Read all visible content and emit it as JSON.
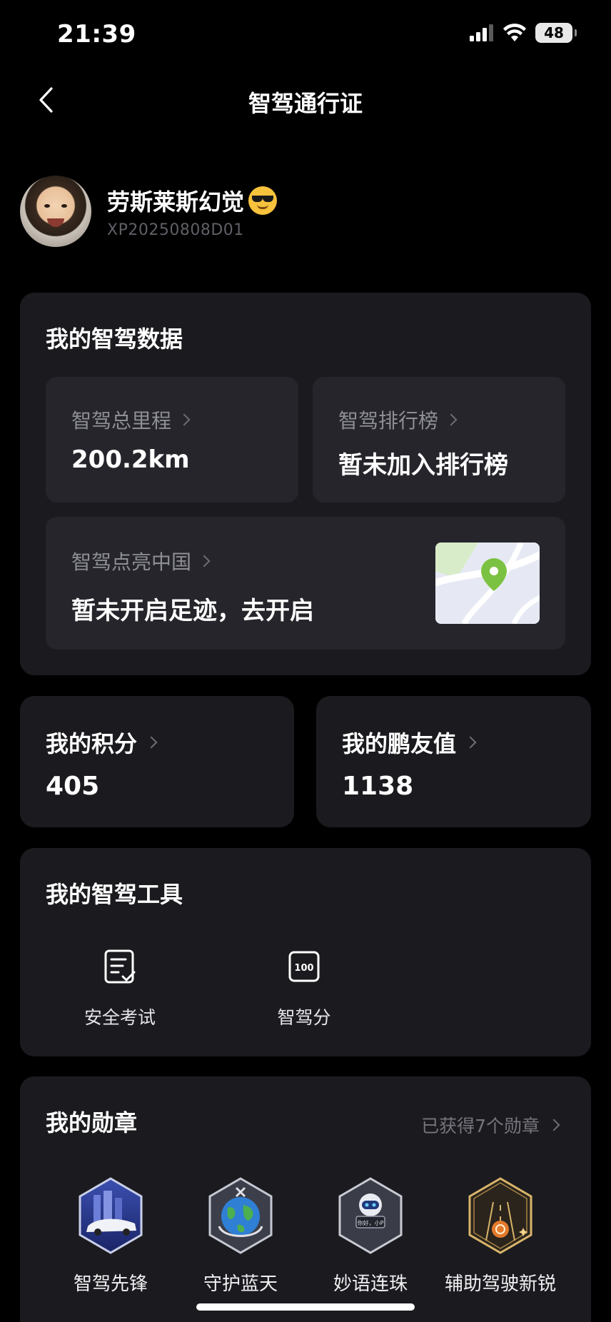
{
  "status_bar": {
    "time": "21:39",
    "battery": "48"
  },
  "nav": {
    "title": "智驾通行证"
  },
  "profile": {
    "name": "劳斯莱斯幻觉",
    "emoji": "sunglasses-emoji",
    "user_id": "XP20250808D01"
  },
  "smart_driving_data": {
    "title": "我的智驾数据",
    "total_mileage": {
      "label": "智驾总里程",
      "value": "200.2km"
    },
    "leaderboard": {
      "label": "智驾排行榜",
      "value": "暂未加入排行榜"
    },
    "light_up_china": {
      "label": "智驾点亮中国",
      "value": "暂未开启足迹，去开启"
    }
  },
  "points": {
    "label": "我的积分",
    "value": "405"
  },
  "friend_value": {
    "label": "我的鹏友值",
    "value": "1138"
  },
  "tools": {
    "title": "我的智驾工具",
    "items": [
      {
        "label": "安全考试",
        "icon": "exam-checklist-icon"
      },
      {
        "label": "智驾分",
        "icon": "score-100-icon",
        "icon_text": "100"
      }
    ]
  },
  "medals": {
    "title": "我的勋章",
    "count_text": "已获得7个勋章",
    "items": [
      {
        "label": "智驾先锋",
        "icon": "pioneer-car-medal-icon"
      },
      {
        "label": "守护蓝天",
        "icon": "earth-medal-icon"
      },
      {
        "label": "妙语连珠",
        "icon": "robot-chat-medal-icon",
        "badge_text": "你好，小P"
      },
      {
        "label": "辅助驾驶新锐",
        "icon": "road-gold-medal-icon"
      }
    ]
  },
  "colors": {
    "background": "#000000",
    "card": "#1b1b1f",
    "sub_card": "#25252b",
    "map_pin": "#7cc242"
  }
}
